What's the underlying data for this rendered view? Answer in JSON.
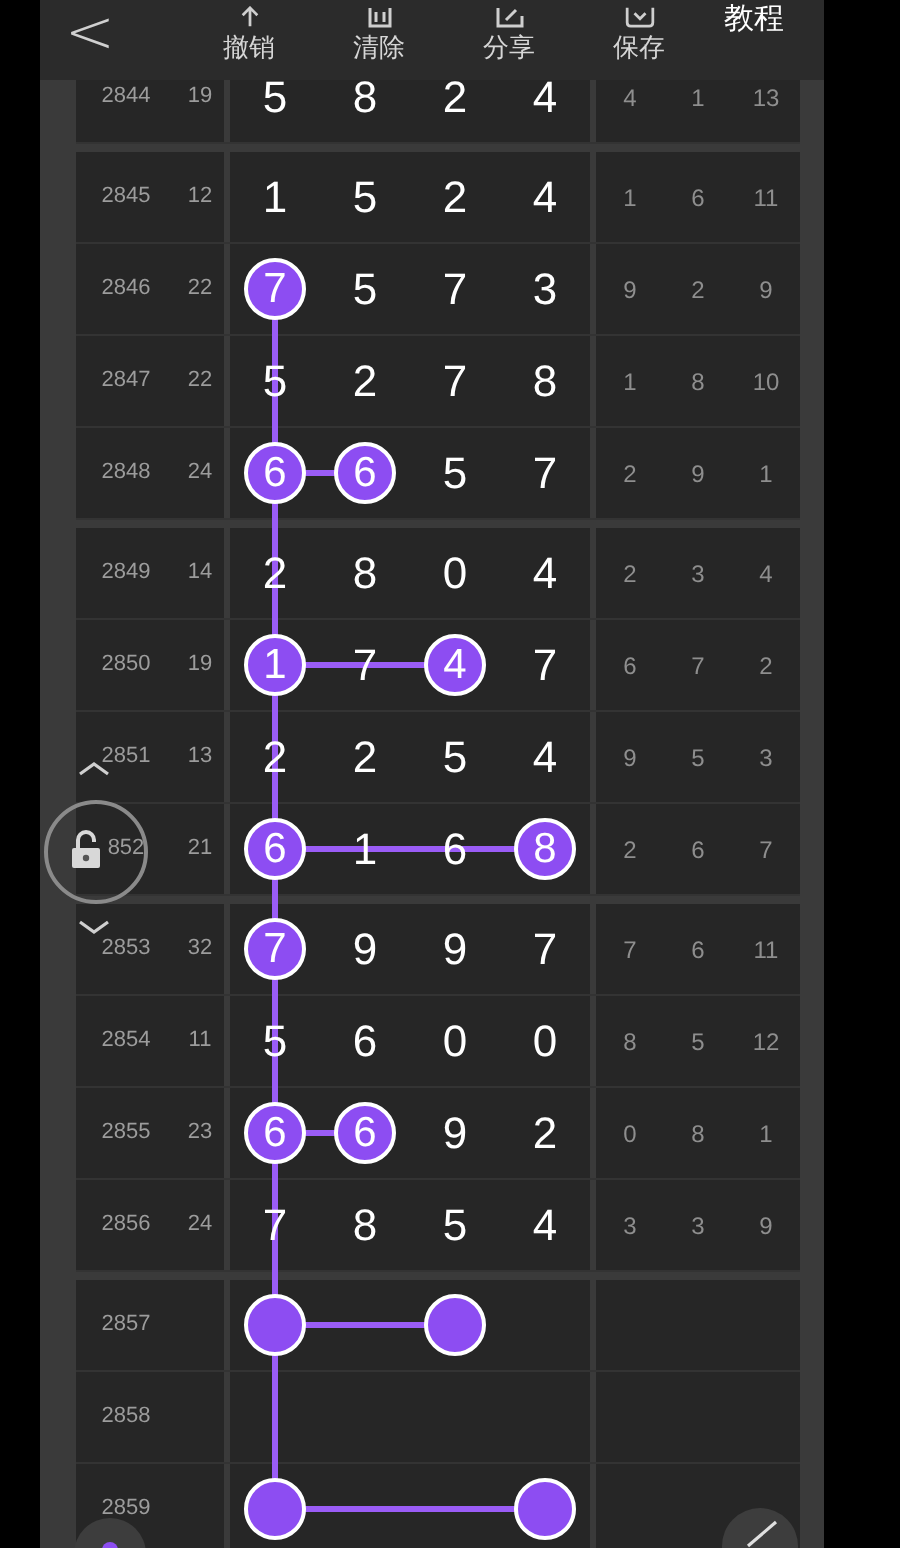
{
  "toolbar": {
    "back": "<",
    "buttons": [
      {
        "kind": "undo",
        "label": "撤销"
      },
      {
        "kind": "clear",
        "label": "清除"
      },
      {
        "kind": "share",
        "label": "分享"
      },
      {
        "kind": "save",
        "label": "保存"
      }
    ],
    "tutorial": "教程"
  },
  "groups": [
    {
      "rows": [
        {
          "issue": "2844",
          "sum": "19",
          "digits": [
            {
              "value": "5",
              "marked": false
            },
            {
              "value": "8",
              "marked": false
            },
            {
              "value": "2",
              "marked": false
            },
            {
              "value": "4",
              "marked": false
            }
          ],
          "stats": [
            "4",
            "1",
            "13"
          ]
        }
      ]
    },
    {
      "rows": [
        {
          "issue": "2845",
          "sum": "12",
          "digits": [
            {
              "value": "1",
              "marked": false
            },
            {
              "value": "5",
              "marked": false
            },
            {
              "value": "2",
              "marked": false
            },
            {
              "value": "4",
              "marked": false
            }
          ],
          "stats": [
            "1",
            "6",
            "11"
          ]
        },
        {
          "issue": "2846",
          "sum": "22",
          "digits": [
            {
              "value": "7",
              "marked": true,
              "link_down": true
            },
            {
              "value": "5",
              "marked": false
            },
            {
              "value": "7",
              "marked": false
            },
            {
              "value": "3",
              "marked": false
            }
          ],
          "stats": [
            "9",
            "2",
            "9"
          ]
        },
        {
          "issue": "2847",
          "sum": "22",
          "digits": [
            {
              "value": "5",
              "marked": false
            },
            {
              "value": "2",
              "marked": false
            },
            {
              "value": "7",
              "marked": false
            },
            {
              "value": "8",
              "marked": false
            }
          ],
          "stats": [
            "1",
            "8",
            "10"
          ]
        },
        {
          "issue": "2848",
          "sum": "24",
          "digits": [
            {
              "value": "6",
              "marked": true,
              "link_down": true,
              "link_right": true
            },
            {
              "value": "6",
              "marked": true
            },
            {
              "value": "5",
              "marked": false
            },
            {
              "value": "7",
              "marked": false
            }
          ],
          "stats": [
            "2",
            "9",
            "1"
          ]
        }
      ]
    },
    {
      "rows": [
        {
          "issue": "2849",
          "sum": "14",
          "digits": [
            {
              "value": "2",
              "marked": false
            },
            {
              "value": "8",
              "marked": false
            },
            {
              "value": "0",
              "marked": false
            },
            {
              "value": "4",
              "marked": false
            }
          ],
          "stats": [
            "2",
            "3",
            "4"
          ]
        },
        {
          "issue": "2850",
          "sum": "19",
          "digits": [
            {
              "value": "1",
              "marked": true,
              "link_down": true,
              "link_right": true
            },
            {
              "value": "7",
              "marked": false
            },
            {
              "value": "4",
              "marked": true
            },
            {
              "value": "7",
              "marked": false
            }
          ],
          "stats": [
            "6",
            "7",
            "2"
          ]
        },
        {
          "issue": "2851",
          "sum": "13",
          "digits": [
            {
              "value": "2",
              "marked": false
            },
            {
              "value": "2",
              "marked": false
            },
            {
              "value": "5",
              "marked": false
            },
            {
              "value": "4",
              "marked": false
            }
          ],
          "stats": [
            "9",
            "5",
            "3"
          ]
        },
        {
          "issue": "852",
          "sum": "21",
          "digits": [
            {
              "value": "6",
              "marked": true,
              "link_down": true,
              "link_right": true
            },
            {
              "value": "1",
              "marked": false
            },
            {
              "value": "6",
              "marked": false
            },
            {
              "value": "8",
              "marked": true
            }
          ],
          "stats": [
            "2",
            "6",
            "7"
          ]
        }
      ]
    },
    {
      "rows": [
        {
          "issue": "2853",
          "sum": "32",
          "digits": [
            {
              "value": "7",
              "marked": true,
              "link_down": true
            },
            {
              "value": "9",
              "marked": false
            },
            {
              "value": "9",
              "marked": false
            },
            {
              "value": "7",
              "marked": false
            }
          ],
          "stats": [
            "7",
            "6",
            "11"
          ]
        },
        {
          "issue": "2854",
          "sum": "11",
          "digits": [
            {
              "value": "5",
              "marked": false
            },
            {
              "value": "6",
              "marked": false
            },
            {
              "value": "0",
              "marked": false
            },
            {
              "value": "0",
              "marked": false
            }
          ],
          "stats": [
            "8",
            "5",
            "12"
          ]
        },
        {
          "issue": "2855",
          "sum": "23",
          "digits": [
            {
              "value": "6",
              "marked": true,
              "link_down": true,
              "link_right": true
            },
            {
              "value": "6",
              "marked": true
            },
            {
              "value": "9",
              "marked": false
            },
            {
              "value": "2",
              "marked": false
            }
          ],
          "stats": [
            "0",
            "8",
            "1"
          ]
        },
        {
          "issue": "2856",
          "sum": "24",
          "digits": [
            {
              "value": "7",
              "marked": false
            },
            {
              "value": "8",
              "marked": false
            },
            {
              "value": "5",
              "marked": false
            },
            {
              "value": "4",
              "marked": false
            }
          ],
          "stats": [
            "3",
            "3",
            "9"
          ]
        }
      ]
    },
    {
      "rows": [
        {
          "issue": "2857",
          "digits": [
            {
              "marked": true,
              "link_down": true,
              "link_right": true
            },
            {
              "marked": false
            },
            {
              "marked": true
            },
            {
              "marked": false
            }
          ]
        },
        {
          "issue": "2858",
          "digits": [
            {
              "marked": false
            },
            {
              "marked": false
            },
            {
              "marked": false
            },
            {
              "marked": false
            }
          ]
        },
        {
          "issue": "2859",
          "digits": [
            {
              "marked": true,
              "link_right": true
            },
            {
              "marked": false
            },
            {
              "marked": false
            },
            {
              "marked": true
            }
          ]
        }
      ]
    }
  ]
}
